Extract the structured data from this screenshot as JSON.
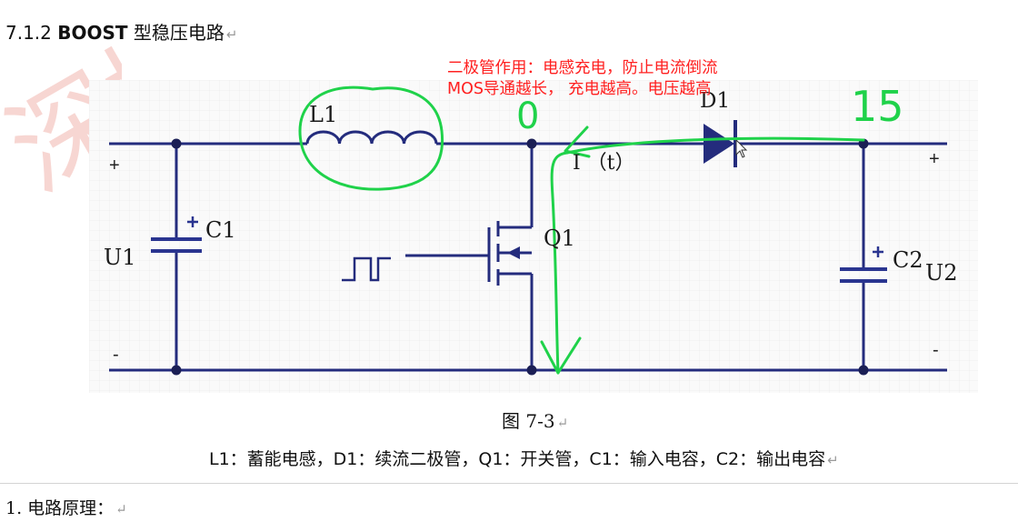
{
  "section": {
    "number": "7.1.2",
    "bold": "BOOST",
    "title": "型稳压电路",
    "para_mark": "↵"
  },
  "watermark": {
    "text": "深圳",
    "color": "#f7d6d2"
  },
  "circuit": {
    "inductor": "L1",
    "diode": "D1",
    "mosfet": "Q1",
    "cap_in": "C1",
    "cap_out": "C2",
    "input_voltage": "U1",
    "output_voltage": "U2",
    "current": "I （t）",
    "plus": "+",
    "minus": "-",
    "wire_color": "#242c7d",
    "node_color": "#1b1f55"
  },
  "annotations": {
    "line1": "二极管作用：电感充电，防止电流倒流",
    "line2": "MOS导通越长，  充电越高。电压越高",
    "color": "#ff2020",
    "hand_left": "0",
    "hand_right": "15",
    "hand_color": "#1fd24a"
  },
  "caption": {
    "text": "图  7-3",
    "para_mark": "↵"
  },
  "legend": {
    "text": "L1：蓄能电感，D1：续流二极管，Q1：开关管，C1：输入电容，C2：输出电容",
    "para_mark": "↵"
  },
  "principle": {
    "text": "1.  电路原理：",
    "para_mark": "↵"
  }
}
